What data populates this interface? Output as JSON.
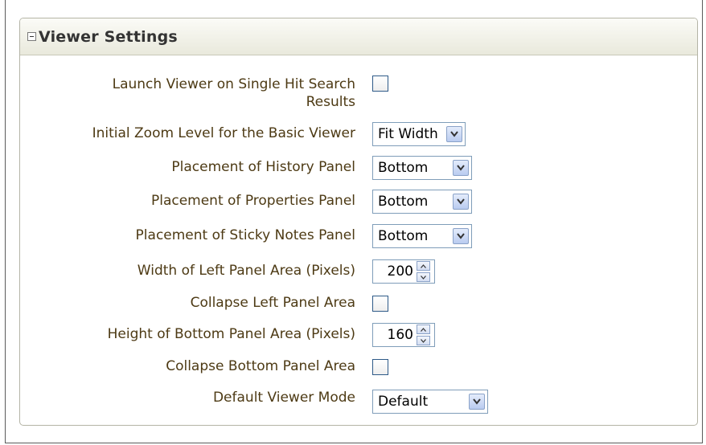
{
  "panel": {
    "title": "Viewer Settings",
    "collapse_icon": "minus-box-icon"
  },
  "settings": {
    "launch_single_hit": {
      "label_line1": "Launch Viewer on Single Hit Search",
      "label_line2": "Results",
      "checked": false
    },
    "initial_zoom": {
      "label": "Initial Zoom Level for the Basic Viewer",
      "value": "Fit Width"
    },
    "history_panel": {
      "label": "Placement of History Panel",
      "value": "Bottom"
    },
    "properties_panel": {
      "label": "Placement of Properties Panel",
      "value": "Bottom"
    },
    "sticky_notes_panel": {
      "label": "Placement of Sticky Notes Panel",
      "value": "Bottom"
    },
    "left_panel_width": {
      "label": "Width of Left Panel Area (Pixels)",
      "value": "200"
    },
    "collapse_left": {
      "label": "Collapse Left Panel Area",
      "checked": false
    },
    "bottom_panel_height": {
      "label": "Height of Bottom Panel Area (Pixels)",
      "value": "160"
    },
    "collapse_bottom": {
      "label": "Collapse Bottom Panel Area",
      "checked": false
    },
    "default_mode": {
      "label": "Default Viewer Mode",
      "value": "Default"
    }
  },
  "colors": {
    "label_text": "#4d3a14",
    "header_gradient_top": "#fbfbf7",
    "header_gradient_bottom": "#e9e9dc",
    "checkbox_border": "#2e5a88"
  }
}
